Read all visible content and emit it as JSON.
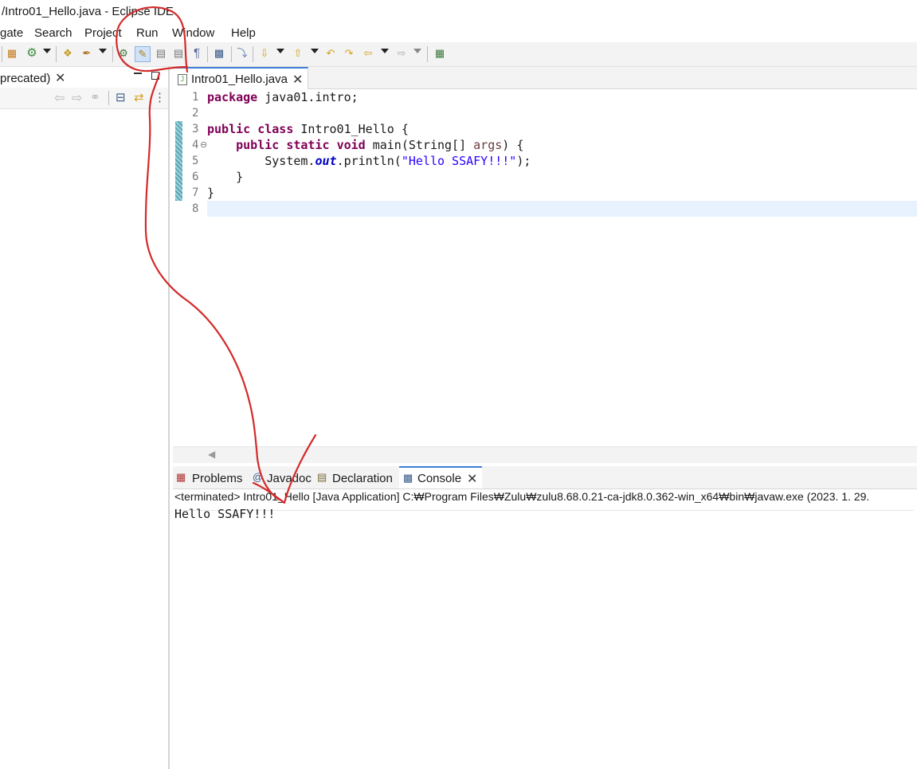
{
  "window": {
    "title": "/Intro01_Hello.java - Eclipse IDE"
  },
  "menu": {
    "items": [
      "gate",
      "Search",
      "Project",
      "Run",
      "Window",
      "Help"
    ]
  },
  "left_panel": {
    "tab_label": "precated)"
  },
  "editor": {
    "tab_label": "Intro01_Hello.java",
    "line_numbers": [
      "1",
      "2",
      "3",
      "4",
      "5",
      "6",
      "7",
      "8"
    ],
    "code": {
      "l1_kw": "package",
      "l1_rest": " java01.intro;",
      "l3_kw1": "public",
      "l3_kw2": "class",
      "l3_rest": " Intro01_Hello {",
      "l4_kw1": "public",
      "l4_kw2": "static",
      "l4_kw3": "void",
      "l4_mid": " main(String[] ",
      "l4_param": "args",
      "l4_end": ") {",
      "l5_pre": "System.",
      "l5_fld": "out",
      "l5_mid": ".println(",
      "l5_str": "\"Hello SSAFY!!!\"",
      "l5_end": ");",
      "l6": "}",
      "l7": "}"
    }
  },
  "bottom_panel": {
    "tabs": [
      "Problems",
      "Javadoc",
      "Declaration",
      "Console"
    ],
    "console_status": "<terminated> Intro01_Hello [Java Application] C:₩Program Files₩Zulu₩zulu8.68.0.21-ca-jdk8.0.362-win_x64₩bin₩javaw.exe  (2023. 1. 29.",
    "console_output": "Hello SSAFY!!!"
  },
  "colors": {
    "accent": "#3d7ed6",
    "keyword": "#7f0055",
    "string": "#2a00ff",
    "field": "#0000c0",
    "annotation": "#d42a2a"
  },
  "icons": [
    "skip-breakpoints-icon",
    "debug-icon",
    "run-icon",
    "open-type-icon",
    "search-icon",
    "toggle-mark-occurrences-icon",
    "toggle-word-wrap-icon",
    "show-whitespace-icon",
    "next-annotation-icon",
    "previous-annotation-icon",
    "back-icon",
    "forward-icon"
  ]
}
